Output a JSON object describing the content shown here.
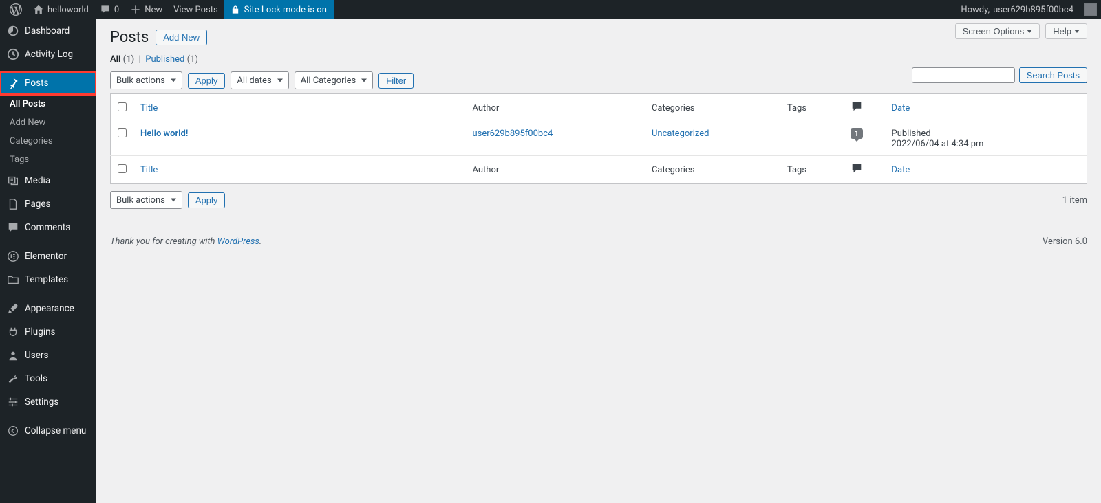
{
  "adminbar": {
    "site_name": "helloworld",
    "comments_count": "0",
    "new_label": "New",
    "view_posts": "View Posts",
    "lock_label": "Site Lock mode is on",
    "howdy_prefix": "Howdy, ",
    "username": "user629b895f00bc4"
  },
  "sidebar": {
    "dashboard": "Dashboard",
    "activity_log": "Activity Log",
    "posts": "Posts",
    "posts_sub": {
      "all_posts": "All Posts",
      "add_new": "Add New",
      "categories": "Categories",
      "tags": "Tags"
    },
    "media": "Media",
    "pages": "Pages",
    "comments": "Comments",
    "elementor": "Elementor",
    "templates": "Templates",
    "appearance": "Appearance",
    "plugins": "Plugins",
    "users": "Users",
    "tools": "Tools",
    "settings": "Settings",
    "collapse": "Collapse menu"
  },
  "top_buttons": {
    "screen_options": "Screen Options",
    "help": "Help"
  },
  "page": {
    "title": "Posts",
    "add_new": "Add New"
  },
  "filters": {
    "all_label": "All",
    "all_count": "(1)",
    "published_label": "Published",
    "published_count": "(1)"
  },
  "tablenav": {
    "bulk_actions": "Bulk actions",
    "apply": "Apply",
    "all_dates": "All dates",
    "all_categories": "All Categories",
    "filter": "Filter",
    "item_count": "1 item",
    "search_button": "Search Posts"
  },
  "table": {
    "cols": {
      "title": "Title",
      "author": "Author",
      "categories": "Categories",
      "tags": "Tags",
      "date": "Date"
    },
    "row": {
      "title": "Hello world!",
      "author": "user629b895f00bc4",
      "category": "Uncategorized",
      "tags": "—",
      "comments": "1",
      "status": "Published",
      "date": "2022/06/04 at 4:34 pm"
    }
  },
  "footer": {
    "thank_you_prefix": "Thank you for creating with ",
    "wp_link": "WordPress",
    "period": ".",
    "version": "Version 6.0"
  }
}
